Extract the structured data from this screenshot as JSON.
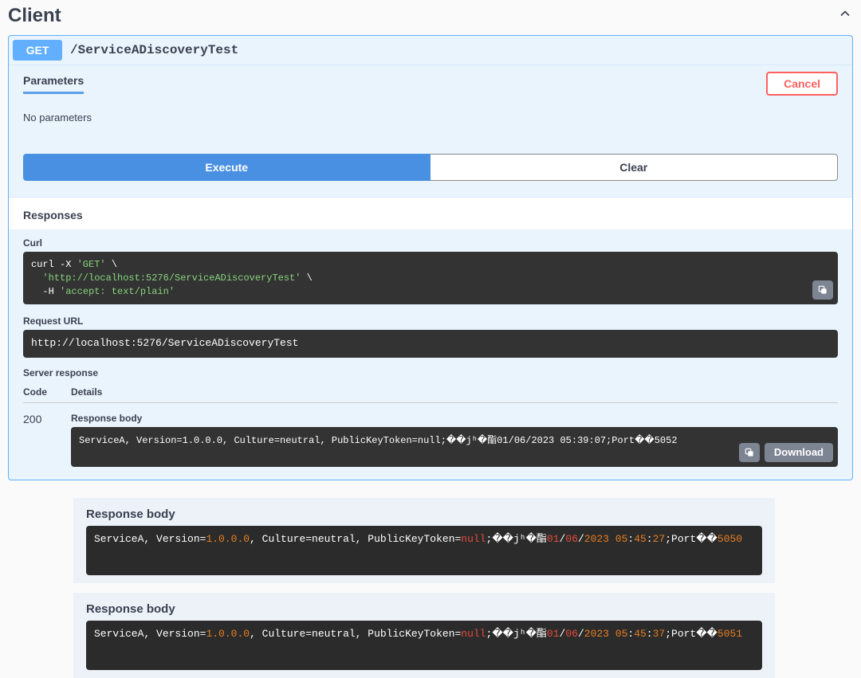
{
  "header": {
    "title": "Client"
  },
  "opblock": {
    "method": "GET",
    "path": "/ServiceADiscoveryTest"
  },
  "params": {
    "title": "Parameters",
    "cancel": "Cancel",
    "empty": "No parameters"
  },
  "actions": {
    "execute": "Execute",
    "clear": "Clear"
  },
  "responses": {
    "title": "Responses",
    "curl_label": "Curl",
    "curl_parts": {
      "c1": "curl -X ",
      "c2": "'GET'",
      "c3": " \\",
      "c4": "'http://localhost:5276/ServiceADiscoveryTest'",
      "c5": " \\",
      "c6": "-H ",
      "c7": "'accept: text/plain'"
    },
    "request_url_label": "Request URL",
    "request_url": "http://localhost:5276/ServiceADiscoveryTest",
    "server_response_label": "Server response",
    "code_col": "Code",
    "details_col": "Details",
    "status": "200",
    "body_label": "Response body",
    "download": "Download",
    "body1": {
      "p1": "ServiceA, Version=",
      "ver": "1.0.0.0",
      "p2": ", Culture=neutral, PublicKeyToken=",
      "nul": "null",
      "p3": ";��jʰ�酯",
      "d1": "01",
      "s1": "/",
      "d2": "06",
      "s2": "/",
      "d3": "2023 05",
      "s3": ":",
      "d4": "39",
      "s4": ":",
      "d5": "07",
      "port_lbl": ";Port��",
      "port": "5052"
    }
  },
  "extra": [
    {
      "label": "Response body",
      "p1": "ServiceA, Version=",
      "ver": "1.0.0.0",
      "p2": ", Culture=neutral, PublicKeyToken=",
      "nul": "null",
      "p3": ";��jʰ�酯",
      "d1": "01",
      "s1": "/",
      "d2": "06",
      "s2": "/",
      "d3": "2023 05",
      "s3": ":",
      "d4": "45",
      "s4": ":",
      "d5": "27",
      "port_lbl": ";Port��",
      "port": "5050"
    },
    {
      "label": "Response body",
      "p1": "ServiceA, Version=",
      "ver": "1.0.0.0",
      "p2": ", Culture=neutral, PublicKeyToken=",
      "nul": "null",
      "p3": ";��jʰ�酯",
      "d1": "01",
      "s1": "/",
      "d2": "06",
      "s2": "/",
      "d3": "2023 05",
      "s3": ":",
      "d4": "45",
      "s4": ":",
      "d5": "37",
      "port_lbl": ";Port��",
      "port": "5051"
    }
  ]
}
